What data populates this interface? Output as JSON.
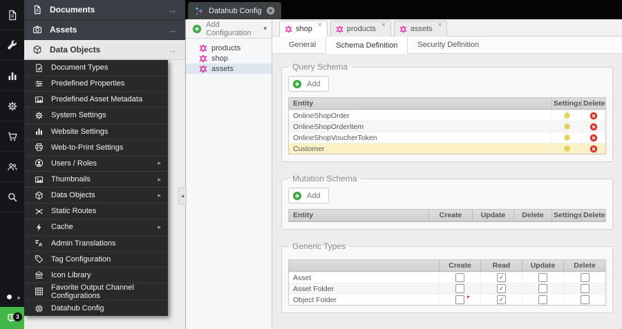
{
  "icons": {
    "arrow_right": "→",
    "caret_right": "▸",
    "caret_down": "▾",
    "collapse_left": "◂",
    "close": "×"
  },
  "icon_bar": {
    "chat_badge": "3"
  },
  "accordion": {
    "items": [
      {
        "label": "Documents",
        "icon": "file-icon"
      },
      {
        "label": "Assets",
        "icon": "camera-icon"
      },
      {
        "label": "Data Objects",
        "icon": "cube-icon",
        "active": true
      }
    ]
  },
  "submenu": {
    "items": [
      {
        "label": "Document Types"
      },
      {
        "label": "Predefined Properties"
      },
      {
        "label": "Predefined Asset Metadata"
      },
      {
        "label": "System Settings"
      },
      {
        "label": "Website Settings"
      },
      {
        "label": "Web-to-Print Settings"
      },
      {
        "label": "Users / Roles",
        "has_submenu": true
      },
      {
        "label": "Thumbnails",
        "has_submenu": true
      },
      {
        "label": "Data Objects",
        "has_submenu": true
      },
      {
        "label": "Static Routes"
      },
      {
        "label": "Cache",
        "has_submenu": true
      },
      {
        "label": "Admin Translations"
      },
      {
        "label": "Tag Configuration"
      },
      {
        "label": "Icon Library"
      },
      {
        "label": "Favorite Output Channel Configurations"
      },
      {
        "label": "Datahub Config"
      }
    ]
  },
  "datahub_panel": {
    "tab_title": "Datahub Config",
    "add_button_label": "Add Configuration",
    "tree_items": [
      {
        "label": "products"
      },
      {
        "label": "shop"
      },
      {
        "label": "assets",
        "selected": true
      }
    ]
  },
  "main": {
    "tabs": [
      {
        "label": "shop",
        "active": true
      },
      {
        "label": "products"
      },
      {
        "label": "assets"
      }
    ],
    "subtabs": [
      {
        "label": "General"
      },
      {
        "label": "Schema Definition",
        "active": true
      },
      {
        "label": "Security Definition"
      }
    ],
    "query_schema": {
      "legend": "Query Schema",
      "add_label": "Add",
      "columns": [
        "Entity",
        "Settings",
        "Delete"
      ],
      "rows": [
        {
          "entity": "OnlineShopOrder"
        },
        {
          "entity": "OnlineShopOrderItem"
        },
        {
          "entity": "OnlineShopVoucherToken"
        },
        {
          "entity": "Customer",
          "highlighted": true
        }
      ]
    },
    "mutation_schema": {
      "legend": "Mutation Schema",
      "add_label": "Add",
      "columns": [
        "Entity",
        "Create",
        "Update",
        "Delete",
        "Settings",
        "Delete"
      ],
      "rows": []
    },
    "generic_types": {
      "legend": "Generic Types",
      "columns": [
        "",
        "Create",
        "Read",
        "Update",
        "Delete"
      ],
      "rows": [
        {
          "name": "Asset",
          "create": false,
          "read": true,
          "update": false,
          "delete": false
        },
        {
          "name": "Asset Folder",
          "create": false,
          "read": true,
          "update": false,
          "delete": false
        },
        {
          "name": "Object Folder",
          "create": false,
          "read": true,
          "update": false,
          "delete": false,
          "dirty": true
        }
      ]
    }
  },
  "colors": {
    "accent_green": "#3fa845",
    "graphql_magenta": "#e10098",
    "settings_yellow": "#dcbf17",
    "delete_red": "#d7352e",
    "highlight_row": "#fcf1c5"
  }
}
